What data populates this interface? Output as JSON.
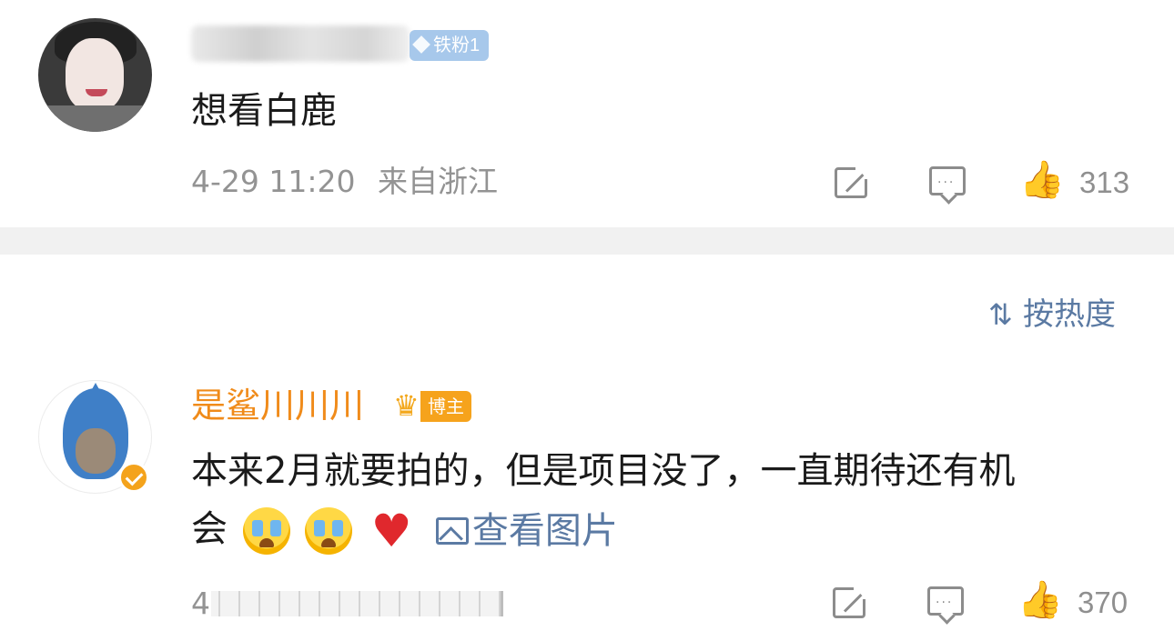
{
  "comments": [
    {
      "username": "",
      "badge": "铁粉1",
      "text": "想看白鹿",
      "time": "4-29 11:20",
      "location": "来自浙江",
      "likes": "313"
    },
    {
      "username": "是鲨川川川",
      "badge": "博主",
      "text": "本来2月就要拍的，但是项目没了，一直期待还有机",
      "text_continued": "会",
      "view_image": "查看图片",
      "time": "4",
      "likes": "370"
    }
  ],
  "sort": {
    "label": "按热度",
    "icon": "sort-icon"
  },
  "colors": {
    "username_highlight": "#f08b1a",
    "link_blue": "#5b7aa3",
    "meta_gray": "#939393",
    "fan_badge": "#a7c8eb",
    "blogger_badge": "#f6a31c"
  },
  "icons": {
    "share": "share-icon",
    "comment": "comment-icon",
    "like": "like-icon",
    "verified": "verified-icon",
    "crown": "crown-icon",
    "image": "image-icon",
    "emoji_cry": "crying-emoji-icon",
    "emoji_heart": "heart-emoji-icon"
  }
}
